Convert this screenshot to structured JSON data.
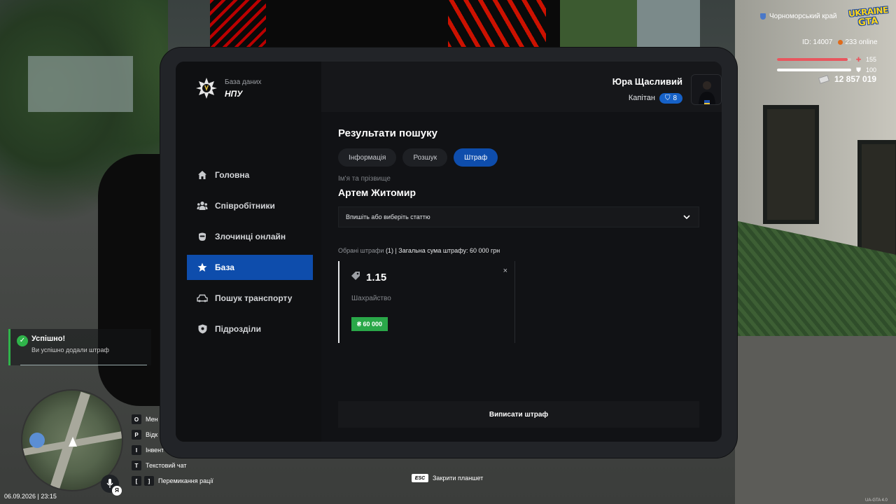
{
  "hud": {
    "region": "Чорноморський край",
    "logo_top": "UKRAINE",
    "logo_bottom": "GTA",
    "id_text": "ID: 14007",
    "online_text": "233 online",
    "health": 155,
    "health_fraction": 0.95,
    "armor": 100,
    "armor_fraction": 1.0,
    "money": "12 857 019",
    "datetime": "06.09.2026 | 23:15",
    "version": "UA-GTA 4.0",
    "voice_key": "Я"
  },
  "toast": {
    "title": "Успішно!",
    "message": "Ви успішно додали штраф"
  },
  "hotkeys": [
    {
      "key": "O",
      "label": "Мен"
    },
    {
      "key": "P",
      "label": "Відк"
    },
    {
      "key": "I",
      "label": "Інвент"
    },
    {
      "key": "T",
      "label": "Текстовий чат"
    },
    {
      "key1": "[",
      "key2": "]",
      "label": "Перемикання рації"
    }
  ],
  "esc_hint": {
    "key": "ESC",
    "label": "Закрити планшет"
  },
  "tablet": {
    "brand_small": "База даних",
    "brand_big": "НПУ",
    "user": {
      "name": "Юра Щасливий",
      "rank": "Капітан",
      "level": "8"
    },
    "nav": [
      {
        "label": "Головна",
        "icon": "home-icon",
        "active": false
      },
      {
        "label": "Співробітники",
        "icon": "people-icon",
        "active": false
      },
      {
        "label": "Злочинці онлайн",
        "icon": "mask-icon",
        "active": false
      },
      {
        "label": "База",
        "icon": "star-icon",
        "active": true
      },
      {
        "label": "Пошук транспорту",
        "icon": "car-icon",
        "active": false
      },
      {
        "label": "Підрозділи",
        "icon": "shield-icon",
        "active": false
      }
    ],
    "page_title": "Результати пошуку",
    "tabs": [
      {
        "label": "Інформація",
        "active": false
      },
      {
        "label": "Розшук",
        "active": false
      },
      {
        "label": "Штраф",
        "active": true
      }
    ],
    "name_label": "Ім'я та прізвище",
    "person_name": "Артем Житомир",
    "select_placeholder": "Впишіть або виберіть статтю",
    "chosen_label": "Обрані штрафи",
    "chosen_count": "(1)",
    "chosen_total": "| Загальна сума штрафу: 60 000 грн",
    "fine": {
      "code": "1.15",
      "description": "Шахрайство",
      "amount": "₴ 60 000",
      "close": "×"
    },
    "submit_label": "Виписати штраф"
  },
  "colors": {
    "accent": "#0e4dac",
    "success": "#2aa849",
    "health": "#e8565e"
  }
}
